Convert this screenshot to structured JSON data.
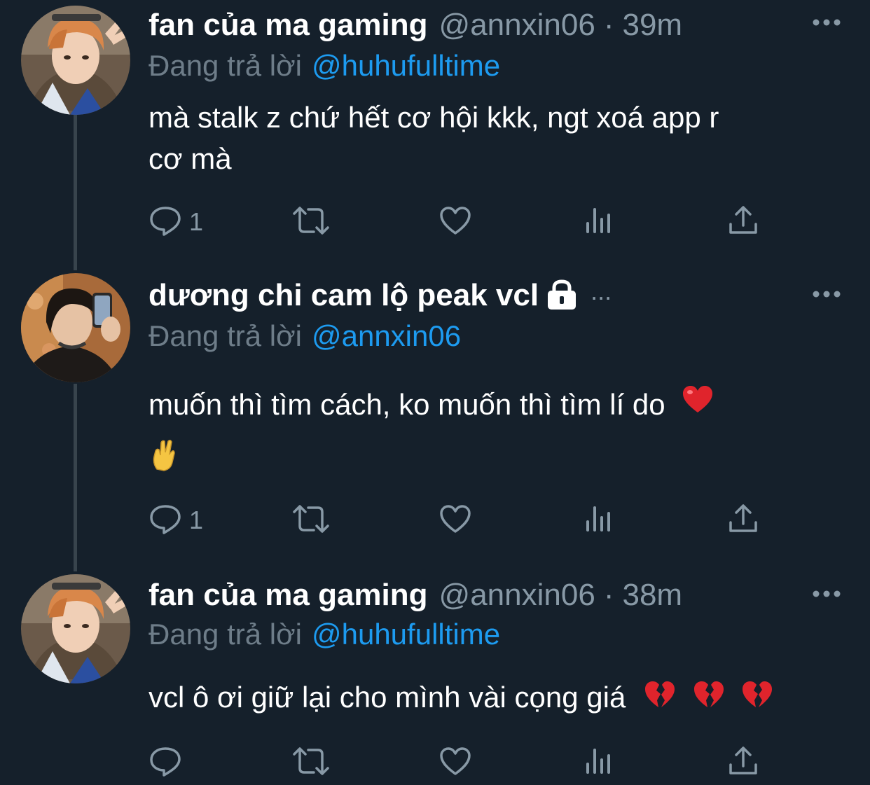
{
  "tweets": [
    {
      "display_name": "fan của ma gaming",
      "handle": "@annxin06",
      "separator": "·",
      "time": "39m",
      "reply_prefix": "Đang trả lời",
      "reply_to": "@huhufulltime",
      "text_lines": [
        "mà stalk z chứ hết cơ hội kkk, ngt xoá app r",
        "cơ mà"
      ],
      "reply_count": "1",
      "avatar": "avatar-orange-hair"
    },
    {
      "display_name": "dương chi cam lộ peak vcl",
      "name_suffix": "...",
      "protected_icon": "lock-icon",
      "reply_prefix": "Đang trả lời",
      "reply_to": "@annxin06",
      "text_lines": [
        "muốn thì tìm cách, ko muốn thì tìm lí do"
      ],
      "emojis": [
        "red-heart-icon",
        "crossed-fingers-icon"
      ],
      "reply_count": "1",
      "avatar": "avatar-dark-hair-phone"
    },
    {
      "display_name": "fan của ma gaming",
      "handle": "@annxin06",
      "separator": "·",
      "time": "38m",
      "reply_prefix": "Đang trả lời",
      "reply_to": "@huhufulltime",
      "text_lines": [
        "vcl ô ơi giữ lại cho mình vài cọng giá"
      ],
      "emojis": [
        "broken-heart-icon",
        "broken-heart-icon",
        "broken-heart-icon"
      ],
      "reply_count": "",
      "avatar": "avatar-orange-hair"
    }
  ],
  "colors": {
    "background": "#15202b",
    "text": "#ffffff",
    "secondary": "#8899a6",
    "link": "#1d9bf0",
    "thread_line": "#38444d"
  },
  "icons": [
    "reply-icon",
    "retweet-icon",
    "like-icon",
    "analytics-icon",
    "share-icon",
    "more-icon"
  ]
}
